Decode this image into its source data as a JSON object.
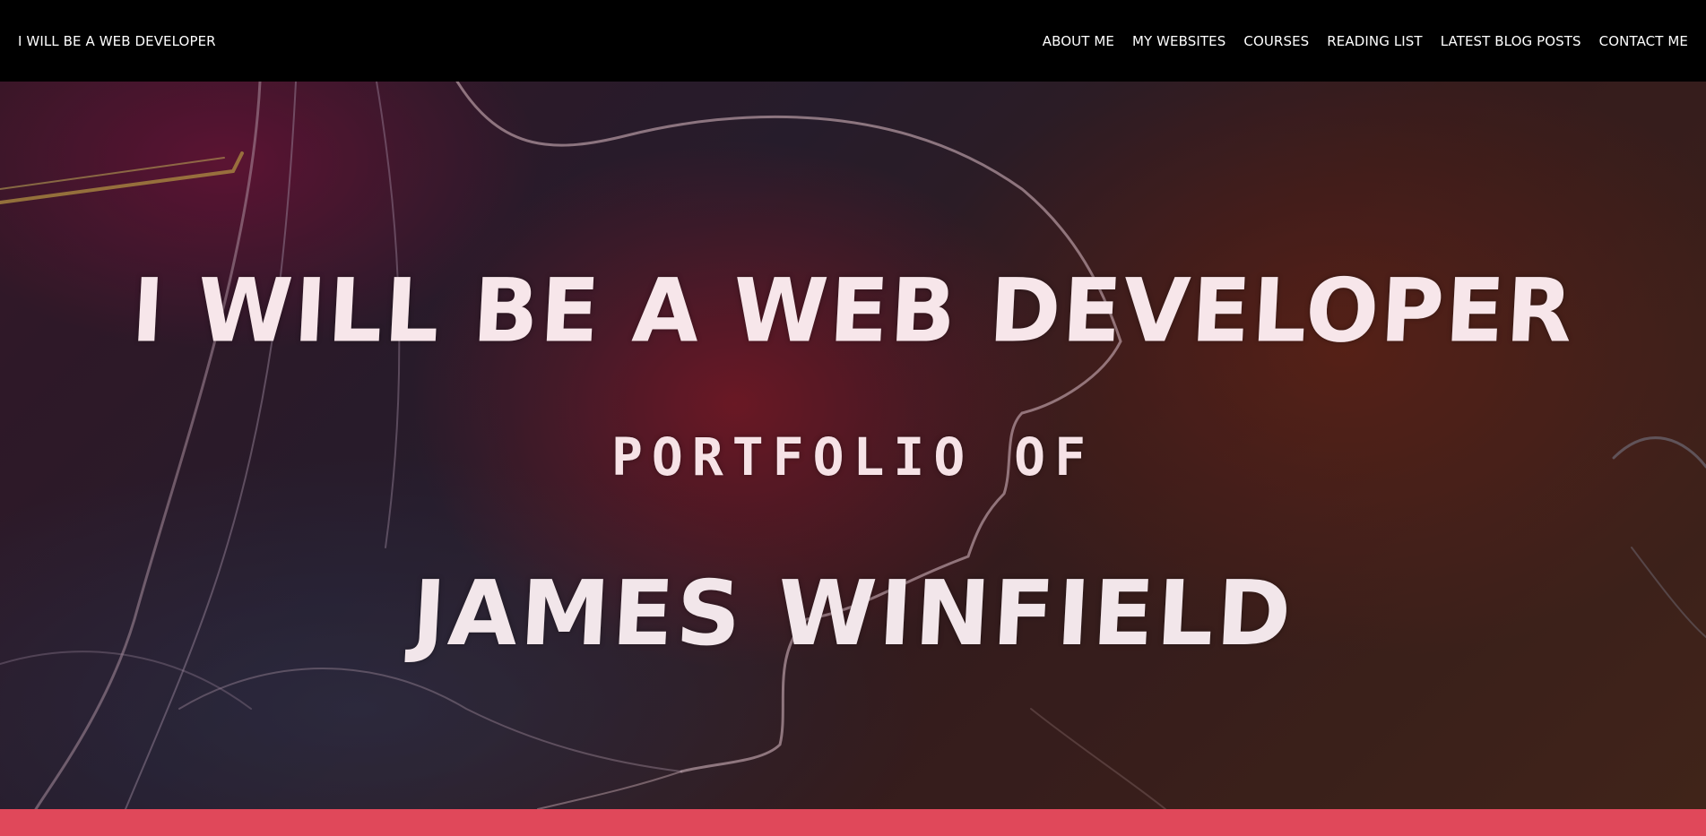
{
  "navbar": {
    "brand": "I WILL BE A WEB DEVELOPER",
    "links": [
      {
        "label": "ABOUT ME"
      },
      {
        "label": "MY WEBSITES"
      },
      {
        "label": "COURSES"
      },
      {
        "label": "READING LIST"
      },
      {
        "label": "LATEST BLOG POSTS"
      },
      {
        "label": "CONTACT ME"
      }
    ]
  },
  "hero": {
    "headline": "I WILL BE A WEB DEVELOPER",
    "subheadline": "PORTFOLIO OF",
    "name": "JAMES WINFIELD",
    "background_image": "stylized-portrait-photo"
  },
  "colors": {
    "navbar_bg": "#000000",
    "accent": "#e0485a",
    "hero_text": "#f7e6ea"
  }
}
